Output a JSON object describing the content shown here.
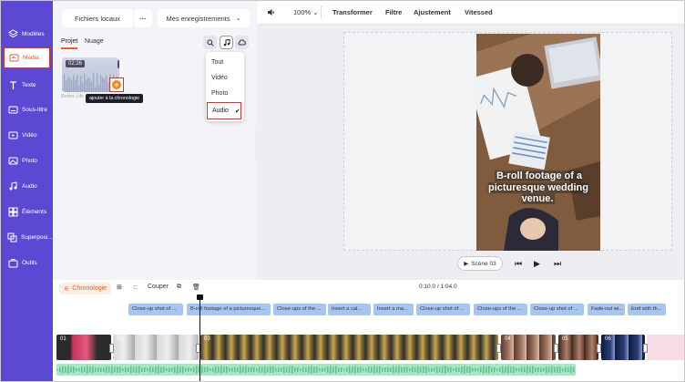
{
  "sidebar": {
    "items": [
      {
        "label": "Modèles",
        "icon": "templates-icon"
      },
      {
        "label": "Média",
        "icon": "media-icon",
        "active": true
      },
      {
        "label": "Texte",
        "icon": "text-icon"
      },
      {
        "label": "Sous-titre",
        "icon": "subtitle-icon"
      },
      {
        "label": "Vidéo",
        "icon": "video-icon"
      },
      {
        "label": "Photo",
        "icon": "photo-icon"
      },
      {
        "label": "Audio",
        "icon": "audio-icon"
      },
      {
        "label": "Éléments",
        "icon": "elements-icon"
      },
      {
        "label": "Superposi...",
        "icon": "overlay-icon"
      },
      {
        "label": "Outils",
        "icon": "tools-icon"
      }
    ]
  },
  "panel": {
    "local_files": "Fichiers locaux",
    "more": "···",
    "recordings": "Mes enregistrements",
    "tabs": [
      "Projet",
      "Nuage"
    ],
    "thumb_duration": "02:26",
    "thumb_name": "Better Life",
    "tooltip": "ajouter à la chronologie",
    "dropdown": [
      "Tout",
      "Vidéo",
      "Photo",
      "Audio"
    ],
    "dropdown_selected": "Audio"
  },
  "toolbar": {
    "zoom": "100%",
    "transform": "Transformer",
    "filter": "Filtre",
    "adjust": "Ajustement",
    "speed": "Vitessed"
  },
  "preview": {
    "caption": "B-roll footage of a picturesque wedding venue.",
    "scene": "Scène 03"
  },
  "timeline": {
    "label": "Chronologie",
    "cut": "Couper",
    "time": "0:10.0 / 1:04.0",
    "text_clips": [
      "Close-up shot of ...",
      "B-roll footage of a picturesque...",
      "Close-ups of the ...",
      "Insert a cal...",
      "Insert a ma...",
      "Close-up shot of ...",
      "Close-ups of the ...",
      "Close-up shot of ...",
      "Fade-out wi...",
      "End with th..."
    ],
    "clip_numbers": [
      "01",
      "02",
      "03",
      "04",
      "05",
      "06"
    ]
  },
  "colors": {
    "sidebar": "#5b49d4",
    "accent": "#ea5b2e",
    "highlight": "#e0302a",
    "text_clip": "#a7c5f1",
    "audio_track": "#a8e6c6"
  }
}
